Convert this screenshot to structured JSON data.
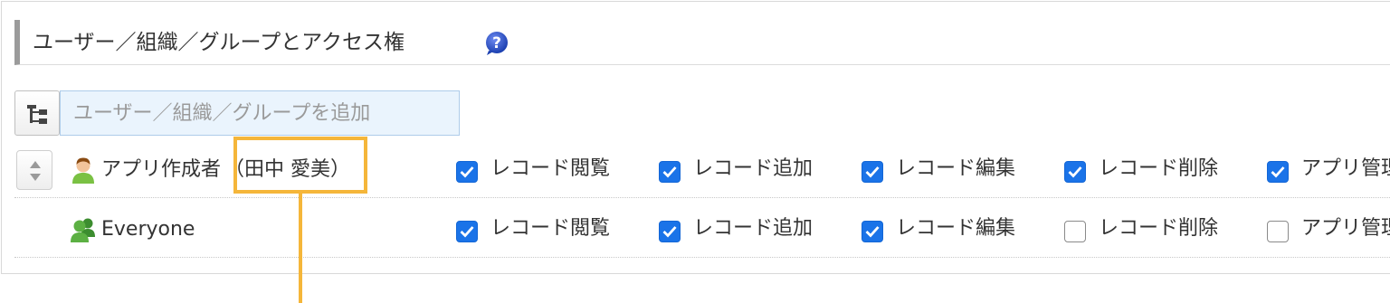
{
  "section": {
    "title": "ユーザー／組織／グループとアクセス権"
  },
  "add_field": {
    "placeholder": "ユーザー／組織／グループを追加",
    "value": ""
  },
  "rows": [
    {
      "name": "アプリ作成者",
      "user": "（田中 愛美）",
      "icon": "user-icon",
      "permissions": [
        {
          "label": "レコード閲覧",
          "checked": true
        },
        {
          "label": "レコード追加",
          "checked": true
        },
        {
          "label": "レコード編集",
          "checked": true
        },
        {
          "label": "レコード削除",
          "checked": true
        },
        {
          "label": "アプリ管理",
          "checked": true
        }
      ]
    },
    {
      "name": "Everyone",
      "user": "",
      "icon": "group-icon",
      "permissions": [
        {
          "label": "レコード閲覧",
          "checked": true
        },
        {
          "label": "レコード追加",
          "checked": true
        },
        {
          "label": "レコード編集",
          "checked": true
        },
        {
          "label": "レコード削除",
          "checked": false
        },
        {
          "label": "アプリ管理",
          "checked": false
        }
      ]
    }
  ],
  "colors": {
    "checkbox_on": "#1a73e8",
    "highlight": "#f5b63a",
    "input_bg": "#eaf4fd",
    "header_bar": "#9b9b9b"
  }
}
